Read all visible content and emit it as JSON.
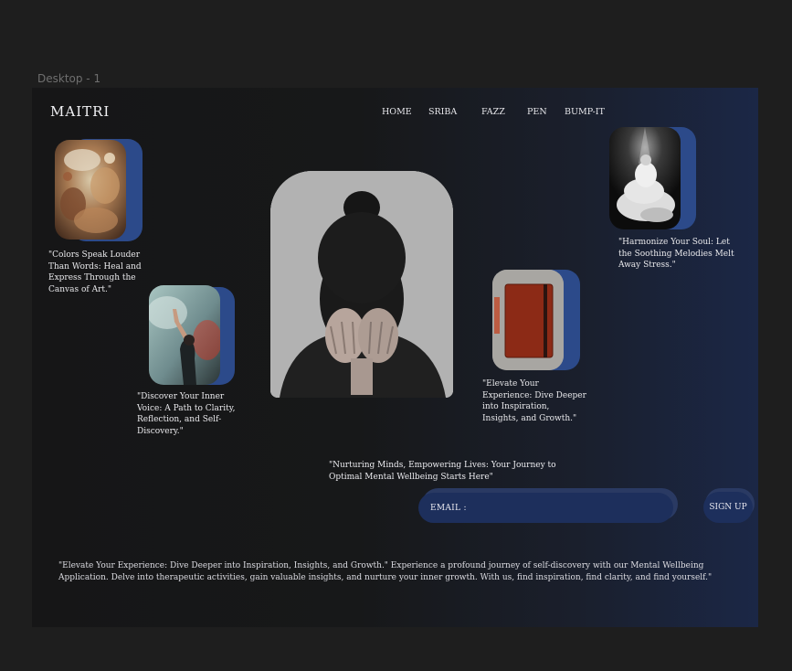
{
  "editor": {
    "frame_label": "Desktop - 1"
  },
  "brand": {
    "logo": "MAITRI"
  },
  "nav": {
    "items": [
      {
        "label": "HOME"
      },
      {
        "label": "SRIBA"
      },
      {
        "label": "FAZZ"
      },
      {
        "label": "PEN"
      },
      {
        "label": "BUMP-IT"
      }
    ]
  },
  "cards": {
    "art": {
      "caption": "\"Colors Speak Louder Than Words: Heal and Express Through the Canvas of Art.\""
    },
    "voice": {
      "caption": "\"Discover Your Inner Voice: A Path to Clarity, Reflection, and Self-Discovery.\""
    },
    "journal": {
      "caption": "\"Elevate Your Experience: Dive Deeper into Inspiration, Insights, and Growth.\""
    },
    "music": {
      "caption": "\"Harmonize Your Soul: Let the Soothing Melodies Melt Away Stress.\""
    }
  },
  "hero": {
    "tagline": "\"Nurturing Minds, Empowering Lives: Your Journey to Optimal Mental Wellbeing Starts Here\""
  },
  "signup": {
    "email_label": "EMAIL :",
    "email_value": "",
    "button_label": "SIGN UP"
  },
  "footer": {
    "text": "\"Elevate Your Experience: Dive Deeper into Inspiration, Insights, and Growth.\" Experience a profound journey of self-discovery with our Mental Wellbeing Application. Delve into therapeutic activities, gain valuable insights, and nurture your inner growth. With us, find inspiration, find clarity, and find yourself.\""
  },
  "colors": {
    "canvas": "#1e1e1e",
    "frame_dark": "#161617",
    "frame_accent": "#1b2746",
    "card_back": "#2c4a8a",
    "input_bg": "#1d2f5c"
  }
}
